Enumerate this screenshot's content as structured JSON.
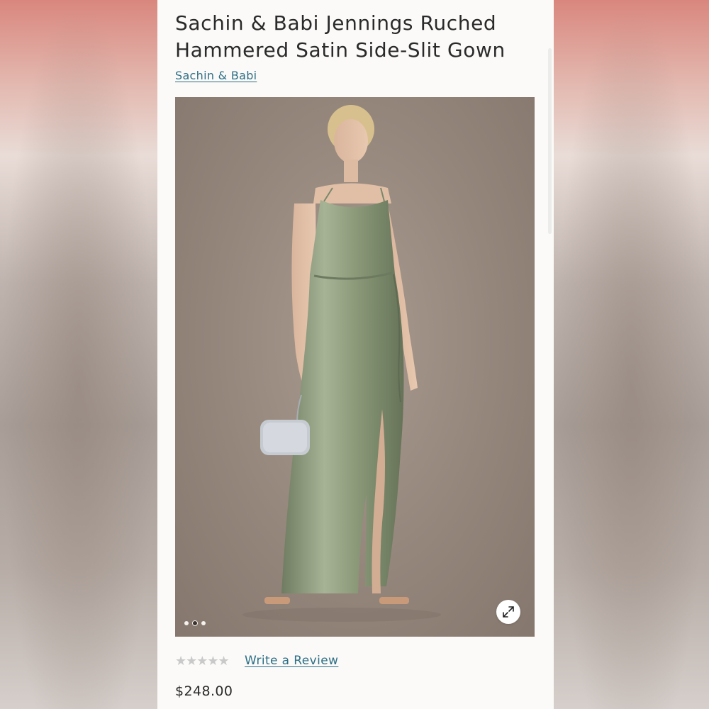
{
  "product": {
    "title": "Sachin & Babi Jennings Ruched Hammered Satin Side-Slit Gown",
    "brand": "Sachin & Babi",
    "price": "$248.00",
    "review_link": "Write a Review",
    "rating_stars": "★★★★★",
    "rating_value": 0
  },
  "gallery": {
    "image_count": 3,
    "active_index": 1,
    "expand_icon": "expand-arrows-icon"
  },
  "colors": {
    "link": "#2d6f86",
    "text": "#2a2a2a",
    "dress": "#8c9a7a",
    "backdrop": "#94867b"
  }
}
